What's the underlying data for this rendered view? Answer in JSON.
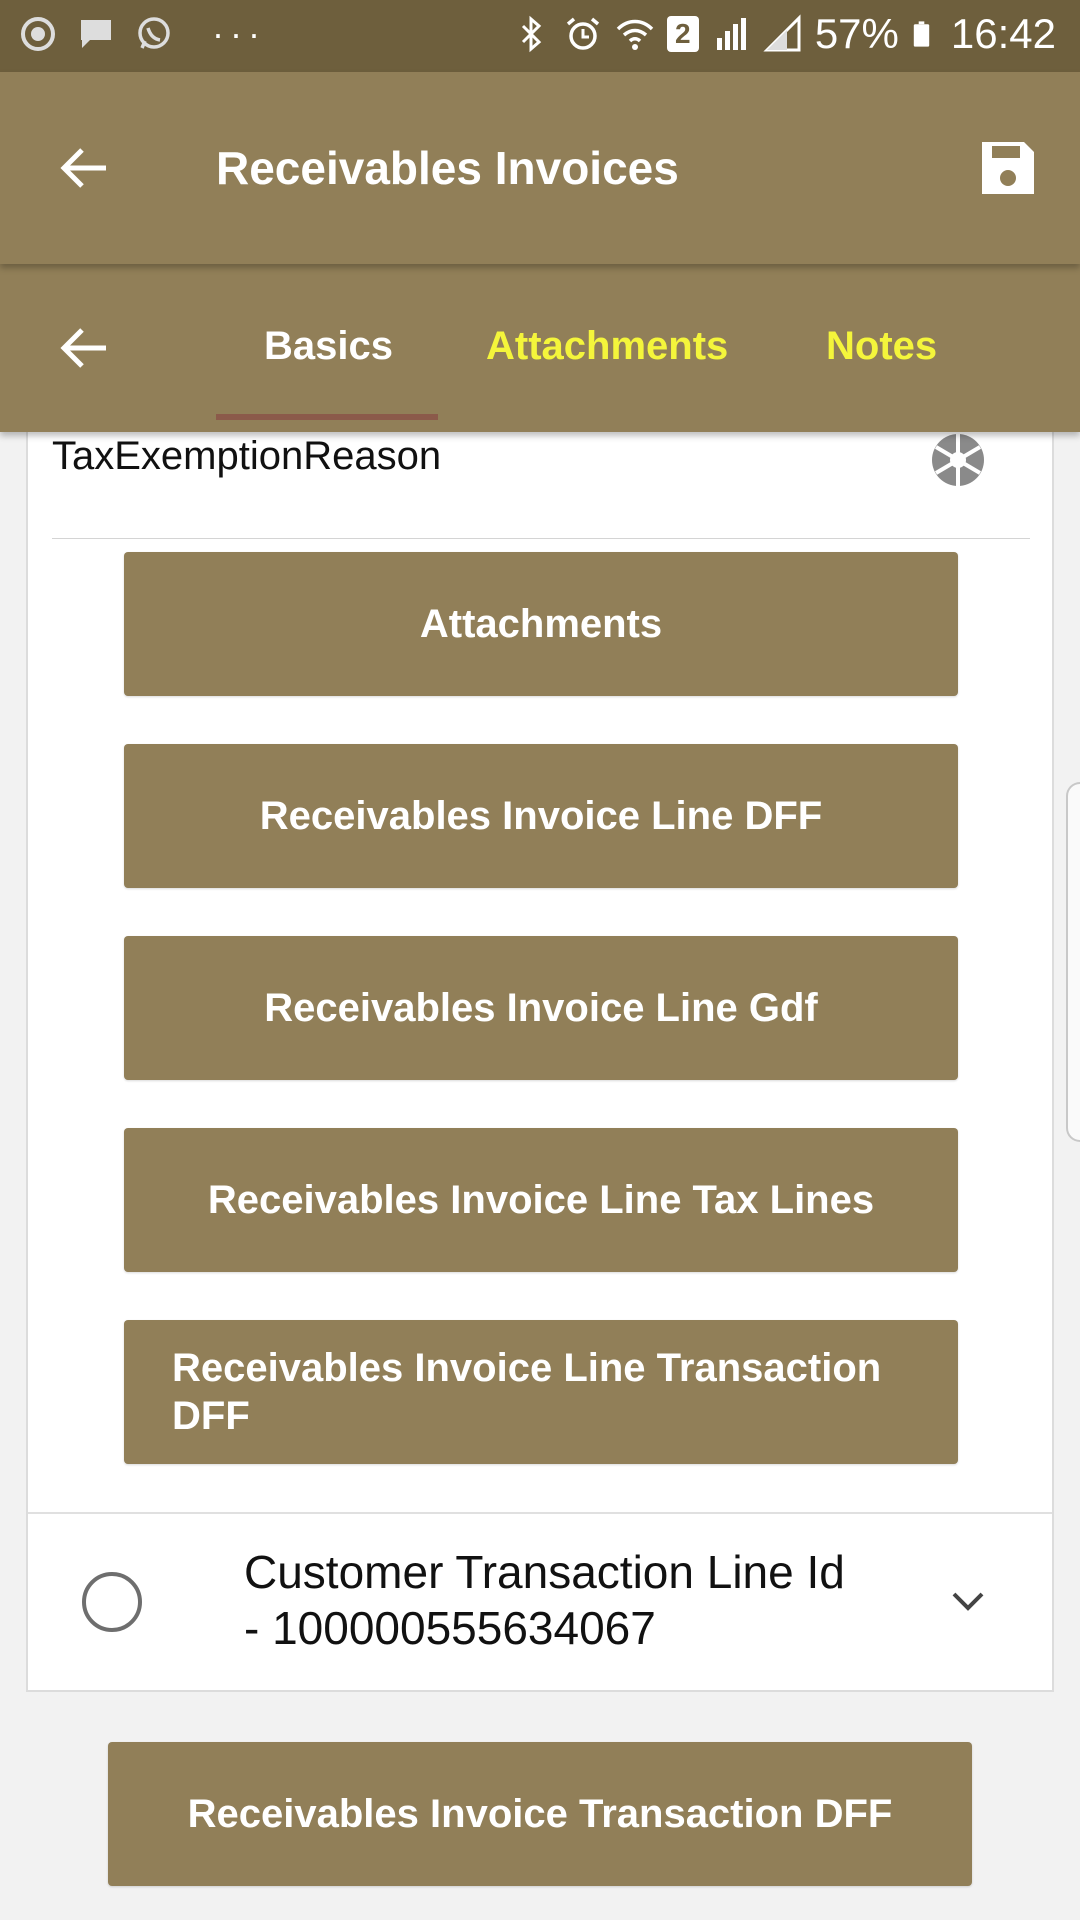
{
  "status_bar": {
    "battery": "57%",
    "time": "16:42",
    "sim_badge": "2"
  },
  "app_bar": {
    "title": "Receivables Invoices"
  },
  "tabs": [
    {
      "label": "Basics",
      "active": true
    },
    {
      "label": "Attachments",
      "active": false
    },
    {
      "label": "Notes",
      "active": false
    }
  ],
  "card": {
    "field_label": "TaxExemptionReason",
    "buttons": [
      "Attachments",
      "Receivables Invoice Line DFF",
      "Receivables Invoice Line Gdf",
      "Receivables Invoice Line Tax Lines",
      "Receivables Invoice Line Transaction DFF"
    ],
    "row": {
      "line1": "Customer Transaction Line Id",
      "line2": "- 100000555634067"
    }
  },
  "footer_button": "Receivables Invoice Transaction DFF",
  "colors": {
    "status_bar": "#6e5f3d",
    "app_bar": "#917f58",
    "tab_inactive": "#f4f53b",
    "tab_indicator": "#8b5a4a"
  }
}
